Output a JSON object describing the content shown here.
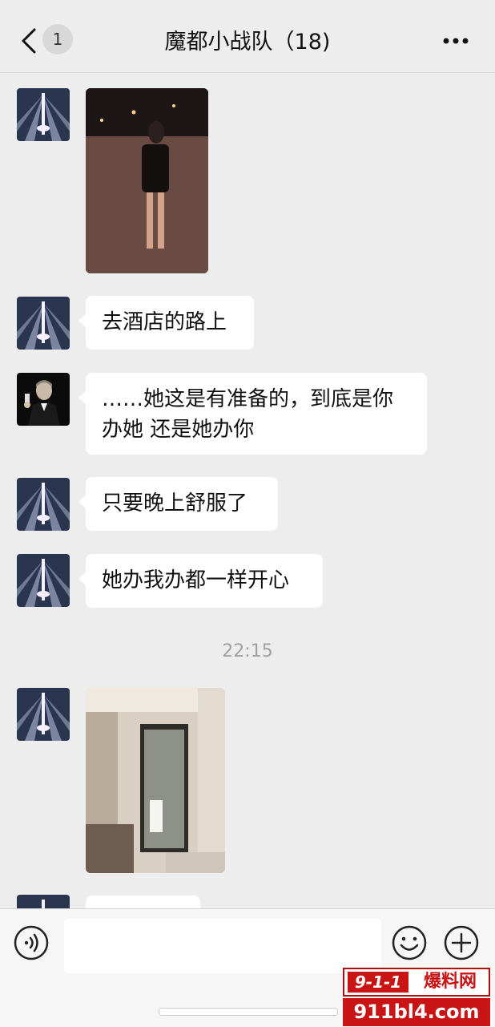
{
  "header": {
    "unread_count": "1",
    "title": "魔都小战队（18)"
  },
  "messages": [
    {
      "type": "image",
      "sender": "tower-avatar",
      "image": "woman-walking-street-night"
    },
    {
      "type": "text",
      "sender": "tower-avatar",
      "text": "去酒店的路上"
    },
    {
      "type": "text",
      "sender": "toast-avatar",
      "lines": [
        "……她这是有准备的，到底是你",
        "办她 还是她办你"
      ]
    },
    {
      "type": "text",
      "sender": "tower-avatar",
      "text": "只要晚上舒服了"
    },
    {
      "type": "text",
      "sender": "tower-avatar",
      "text": "她办我办都一样开心"
    },
    {
      "type": "image",
      "sender": "tower-avatar",
      "image": "hotel-bathroom-glass-door"
    }
  ],
  "timestamp": "22:15",
  "input_bar": {
    "voice_icon": "voice-icon",
    "emoji_icon": "emoji-icon",
    "plus_icon": "plus-icon"
  },
  "watermark": {
    "logo": "9-1-1",
    "logo_text": "爆料网",
    "url": "911bl4.com"
  },
  "colors": {
    "background": "#ededed",
    "bubble": "#ffffff",
    "timestamp": "#a0a0a0",
    "watermark_red": "#c81414"
  }
}
